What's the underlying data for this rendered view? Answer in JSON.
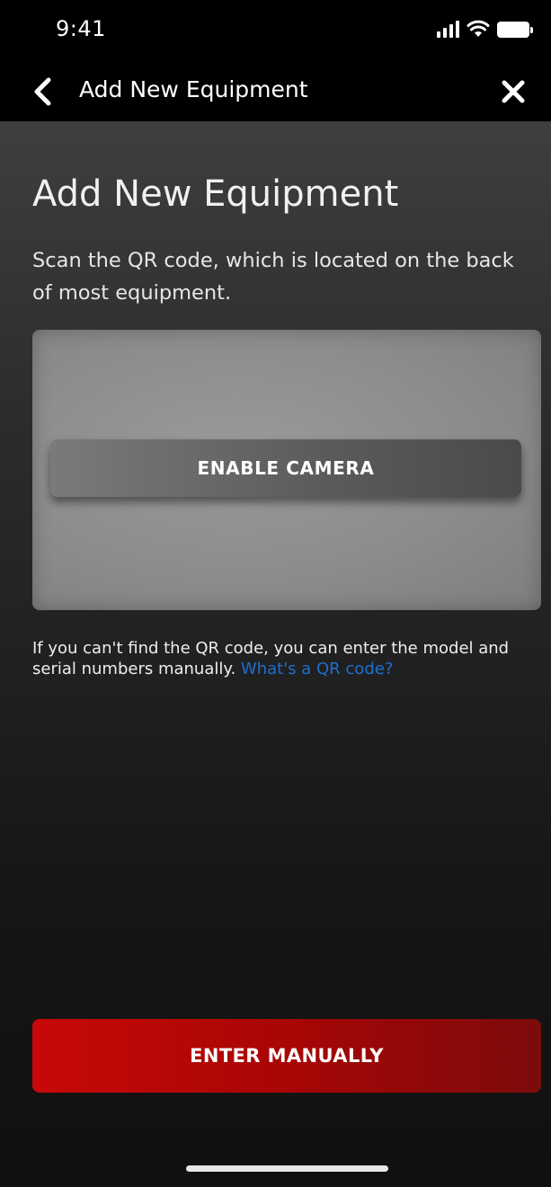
{
  "status_bar": {
    "time": "9:41",
    "icons": [
      "signal-icon",
      "wifi-icon",
      "battery-icon"
    ]
  },
  "nav": {
    "title": "Add New Equipment",
    "back_icon": "chevron-left-icon",
    "close_icon": "close-icon"
  },
  "content": {
    "heading": "Add New Equipment",
    "instructions": "Scan the QR code, which is located on the back of most equipment.",
    "enable_camera_label": "ENABLE CAMERA",
    "help_text": "If you can't find the QR code, you can enter the model and serial numbers manually.",
    "help_link": "What's a QR code?"
  },
  "footer": {
    "enter_manually_label": "ENTER MANUALLY"
  },
  "colors": {
    "primary_red": "#c80808",
    "link_blue": "#1e6fd0",
    "nav_background": "#000000"
  }
}
